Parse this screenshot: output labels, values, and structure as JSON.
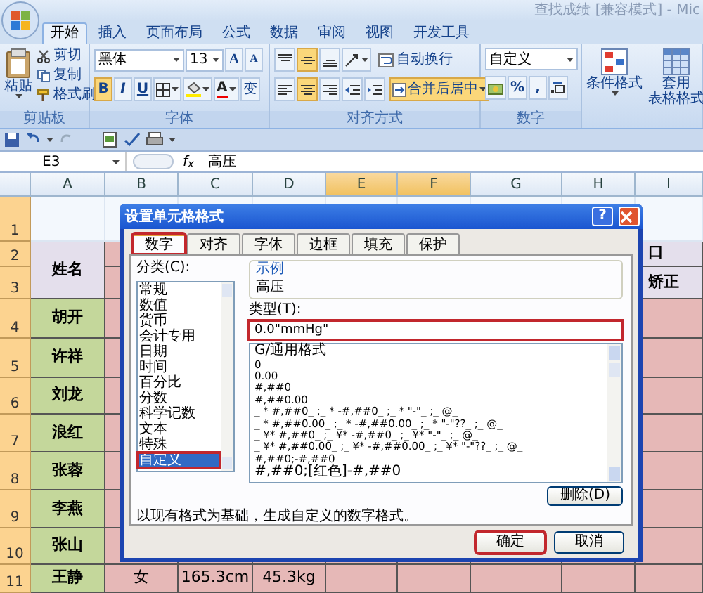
{
  "window": {
    "title": "查找成绩 [兼容模式] - Mic"
  },
  "ribbon_tabs": [
    {
      "label": "开始",
      "selected": true
    },
    {
      "label": "插入",
      "selected": false
    },
    {
      "label": "页面布局",
      "selected": false
    },
    {
      "label": "公式",
      "selected": false
    },
    {
      "label": "数据",
      "selected": false
    },
    {
      "label": "审阅",
      "selected": false
    },
    {
      "label": "视图",
      "selected": false
    },
    {
      "label": "开发工具",
      "selected": false
    }
  ],
  "clipboard": {
    "paste": "粘贴",
    "cut": "剪切",
    "copy": "复制",
    "format_painter": "格式刷",
    "group_label": "剪贴板"
  },
  "font": {
    "name": "黑体",
    "size": "13",
    "grow": "A",
    "shrink": "A",
    "bold": {
      "label": "B",
      "selected": true
    },
    "italic": {
      "label": "I",
      "selected": false
    },
    "underline": {
      "label": "U",
      "selected": false
    },
    "color_letter": "A",
    "phonetic": "变",
    "group_label": "字体"
  },
  "alignment": {
    "vertical": [
      {
        "kind": "top",
        "selected": false
      },
      {
        "kind": "middle",
        "selected": true
      },
      {
        "kind": "bottom",
        "selected": false
      }
    ],
    "horizontal": [
      {
        "kind": "left",
        "selected": false
      },
      {
        "kind": "center",
        "selected": true
      },
      {
        "kind": "right",
        "selected": false
      }
    ],
    "wrap_text": "自动换行",
    "merge_center": {
      "label": "合并后居中",
      "selected": true
    },
    "group_label": "对齐方式"
  },
  "number": {
    "format": "自定义",
    "percent": "%",
    "comma": ",",
    "group_label": "数字"
  },
  "styles": {
    "conditional": "条件格式",
    "table_line_1": "套用",
    "table_line_2": "表格格式"
  },
  "formula_bar": {
    "cell": "E3",
    "function_label": "f$_{x}$",
    "value": "高压"
  },
  "columns": [
    {
      "label": "A",
      "selected": false
    },
    {
      "label": "B",
      "selected": false
    },
    {
      "label": "C",
      "selected": false
    },
    {
      "label": "D",
      "selected": false
    },
    {
      "label": "E",
      "selected": true
    },
    {
      "label": "F",
      "selected": true
    },
    {
      "label": "G",
      "selected": false
    },
    {
      "label": "H",
      "selected": false
    },
    {
      "label": "I",
      "selected": false
    }
  ],
  "rows": [
    {
      "number": "1",
      "kind": "title"
    },
    {
      "number": "2",
      "kind": "header",
      "name": "姓名",
      "name_merged_down": true,
      "column_9": "口"
    },
    {
      "number": "3",
      "kind": "header",
      "column_9": "矫正"
    },
    {
      "number": "4",
      "kind": "data",
      "name": "胡开"
    },
    {
      "number": "5",
      "kind": "data",
      "name": "许祥"
    },
    {
      "number": "6",
      "kind": "data",
      "name": "刘龙"
    },
    {
      "number": "7",
      "kind": "data",
      "name": "浪红"
    },
    {
      "number": "8",
      "kind": "data",
      "name": "张蓉"
    },
    {
      "number": "9",
      "kind": "data",
      "name": "李燕"
    },
    {
      "number": "10",
      "kind": "data",
      "name": "张山"
    },
    {
      "number": "11",
      "kind": "data",
      "name": "王静",
      "column_2": "女",
      "column_3": "165.3cm",
      "column_4": "45.3kg"
    }
  ],
  "dialog": {
    "title": "设置单元格格式",
    "help": "?",
    "tabs": [
      {
        "label": "数字",
        "selected": true,
        "marked": true
      },
      {
        "label": "对齐",
        "selected": false,
        "marked": false
      },
      {
        "label": "字体",
        "selected": false,
        "marked": false
      },
      {
        "label": "边框",
        "selected": false,
        "marked": false
      },
      {
        "label": "填充",
        "selected": false,
        "marked": false
      },
      {
        "label": "保护",
        "selected": false,
        "marked": false
      }
    ],
    "category_label": "分类(C):",
    "categories": [
      {
        "label": "常规",
        "selected": false
      },
      {
        "label": "数值",
        "selected": false
      },
      {
        "label": "货币",
        "selected": false
      },
      {
        "label": "会计专用",
        "selected": false
      },
      {
        "label": "日期",
        "selected": false
      },
      {
        "label": "时间",
        "selected": false
      },
      {
        "label": "百分比",
        "selected": false
      },
      {
        "label": "分数",
        "selected": false
      },
      {
        "label": "科学记数",
        "selected": false
      },
      {
        "label": "文本",
        "selected": false
      },
      {
        "label": "特殊",
        "selected": false
      },
      {
        "label": "自定义",
        "selected": true,
        "marked": true
      }
    ],
    "sample_label": "示例",
    "sample_value": "高压",
    "type_label": "类型(T):",
    "type_value": "0.0\"mmHg\"",
    "type_marked": true,
    "formats": [
      "G/通用格式",
      "0",
      "0.00",
      "#,##0",
      "#,##0.00",
      "_ * #,##0_ ;_ * -#,##0_ ;_ * \"-\"_ ;_ @_",
      "_ * #,##0.00_ ;_ * -#,##0.00_ ;_ * \"-\"??_ ;_ @_",
      "_ ¥* #,##0_ ;_ ¥* -#,##0_ ;_ ¥* \"-\"_ ;_ @_",
      "_ ¥* #,##0.00_ ;_ ¥* -#,##0.00_ ;_ ¥* \"-\"??_ ;_ @_",
      "#,##0;-#,##0",
      "#,##0;[红色]-#,##0"
    ],
    "delete_button": "删除(D)",
    "description": "以现有格式为基础，生成自定义的数字格式。",
    "buttons": [
      {
        "label": "确定",
        "marked": true
      },
      {
        "label": "取消",
        "marked": false
      }
    ]
  }
}
